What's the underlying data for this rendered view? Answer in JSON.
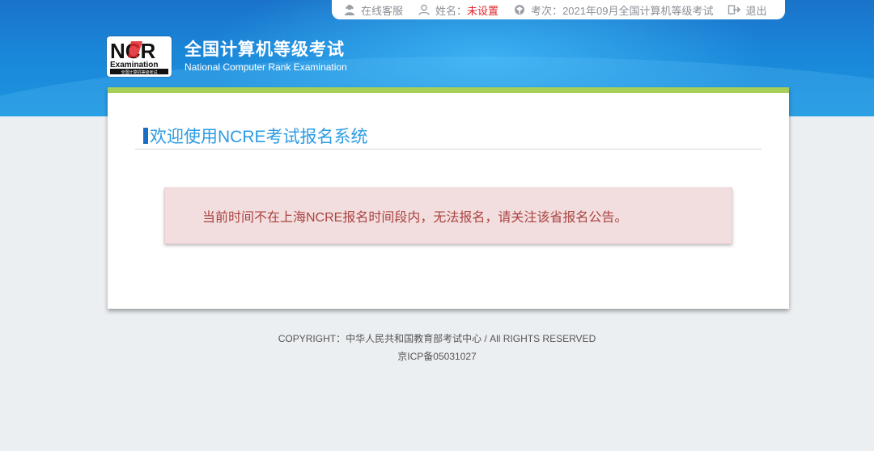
{
  "topbar": {
    "service_label": "在线客服",
    "name_label": "姓名：",
    "name_value": "未设置",
    "exam_label": "考次：",
    "exam_value": "2021年09月全国计算机等级考试",
    "logout_label": "退出",
    "icons": [
      "support-agent-icon",
      "user-icon",
      "exam-icon",
      "logout-icon"
    ]
  },
  "logo": {
    "mark_text": "NCR",
    "mark_sub": "Examination",
    "mark_caption": "全国计算机等级考试",
    "title_cn": "全国计算机等级考试",
    "title_en": "National Computer Rank Examination"
  },
  "main": {
    "title": "欢迎使用NCRE考试报名系统",
    "alert_text": "当前时间不在上海NCRE报名时间段内，无法报名，请关注该省报名公告。"
  },
  "footer": {
    "copyright": "COPYRIGHT：中华人民共和国教育部考试中心 / All RIGHTS RESERVED",
    "icp": "京ICP备05031027"
  },
  "colors": {
    "header_blue": "#1a86d8",
    "accent_green": "#a7cf57",
    "title_blue": "#2d9be4",
    "alert_bg": "#f2dede",
    "alert_text": "#a94442",
    "warn_red": "#e0242a"
  }
}
